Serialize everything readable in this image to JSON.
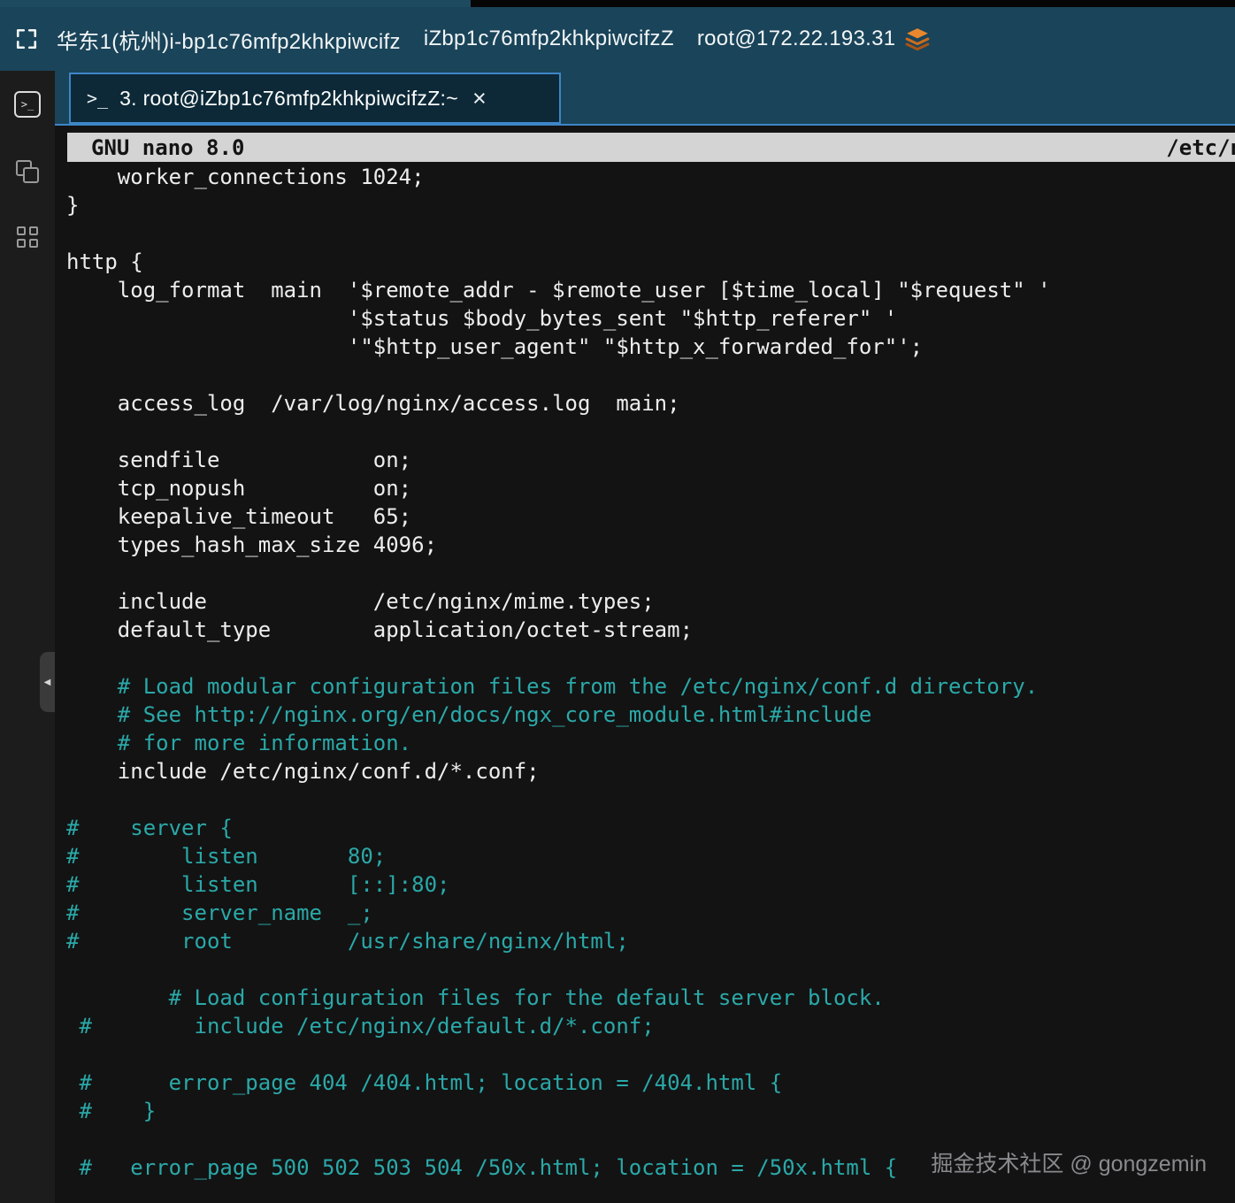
{
  "colors": {
    "topbar_bg": "#1a4459",
    "tab_active_border": "#3e86c8",
    "editor_bg": "#131313",
    "comment_text": "#2ba8a8",
    "plain_text": "#ededed",
    "nano_bar_bg": "#d4d4d4",
    "stack_icon_orange": "#e8872e"
  },
  "icons": {
    "topbar_left": "fullscreen-icon",
    "topbar_right": "layers-icon",
    "sidebar": [
      "terminal-icon",
      "copy-icon",
      "grid-icon"
    ],
    "tab_prompt": "terminal-prompt-icon",
    "collapse": "chevron-left-icon",
    "terminal_glyph": ">_",
    "chevron_glyph": "◀"
  },
  "topbar": {
    "instance": "华东1(杭州)i-bp1c76mfp2khkpiwcifz",
    "hostname": "iZbp1c76mfp2khkpiwcifzZ",
    "login": "root@172.22.193.31"
  },
  "tab": {
    "prompt": ">_",
    "label": "3. root@iZbp1c76mfp2khkpiwcifzZ:~",
    "close": "×"
  },
  "nano": {
    "title_left": "GNU nano 8.0",
    "title_right": "/etc/n"
  },
  "editor": {
    "lines": [
      {
        "t": "    worker_connections 1024;",
        "c": "p"
      },
      {
        "t": "}",
        "c": "p"
      },
      {
        "t": "",
        "c": "p"
      },
      {
        "t": "http {",
        "c": "p"
      },
      {
        "t": "    log_format  main  '$remote_addr - $remote_user [$time_local] \"$request\" '",
        "c": "p"
      },
      {
        "t": "                      '$status $body_bytes_sent \"$http_referer\" '",
        "c": "p"
      },
      {
        "t": "                      '\"$http_user_agent\" \"$http_x_forwarded_for\"';",
        "c": "p"
      },
      {
        "t": "",
        "c": "p"
      },
      {
        "t": "    access_log  /var/log/nginx/access.log  main;",
        "c": "p"
      },
      {
        "t": "",
        "c": "p"
      },
      {
        "t": "    sendfile            on;",
        "c": "p"
      },
      {
        "t": "    tcp_nopush          on;",
        "c": "p"
      },
      {
        "t": "    keepalive_timeout   65;",
        "c": "p"
      },
      {
        "t": "    types_hash_max_size 4096;",
        "c": "p"
      },
      {
        "t": "",
        "c": "p"
      },
      {
        "t": "    include             /etc/nginx/mime.types;",
        "c": "p"
      },
      {
        "t": "    default_type        application/octet-stream;",
        "c": "p"
      },
      {
        "t": "",
        "c": "p"
      },
      {
        "t": "    # Load modular configuration files from the /etc/nginx/conf.d directory.",
        "c": "c"
      },
      {
        "t": "    # See http://nginx.org/en/docs/ngx_core_module.html#include",
        "c": "c"
      },
      {
        "t": "    # for more information.",
        "c": "c"
      },
      {
        "t": "    include /etc/nginx/conf.d/*.conf;",
        "c": "p"
      },
      {
        "t": "",
        "c": "p"
      },
      {
        "t": "#    server {",
        "c": "c"
      },
      {
        "t": "#        listen       80;",
        "c": "c"
      },
      {
        "t": "#        listen       [::]:80;",
        "c": "c"
      },
      {
        "t": "#        server_name  _;",
        "c": "c"
      },
      {
        "t": "#        root         /usr/share/nginx/html;",
        "c": "c"
      },
      {
        "t": "",
        "c": "p"
      },
      {
        "t": "        # Load configuration files for the default server block.",
        "c": "c"
      },
      {
        "t": " #        include /etc/nginx/default.d/*.conf;",
        "c": "c"
      },
      {
        "t": "",
        "c": "p"
      },
      {
        "t": " #      error_page 404 /404.html; location = /404.html {",
        "c": "c"
      },
      {
        "t": " #    }",
        "c": "c"
      },
      {
        "t": "",
        "c": "p"
      },
      {
        "t": " #   error_page 500 502 503 504 /50x.html; location = /50x.html {",
        "c": "c"
      }
    ]
  },
  "watermark": "掘金技术社区 @ gongzemin"
}
